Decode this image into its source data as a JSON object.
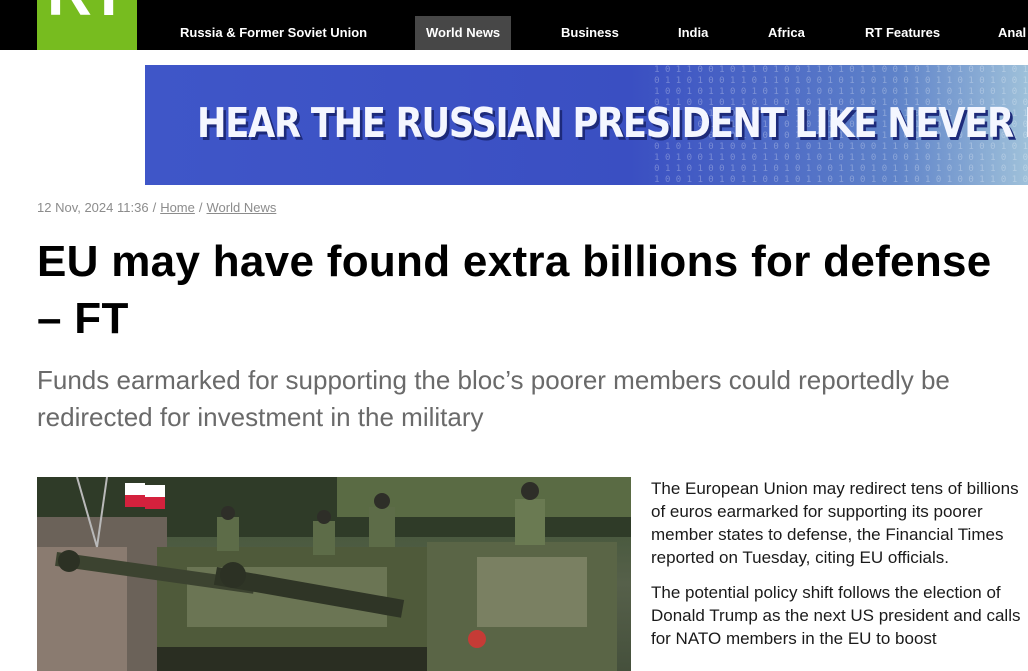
{
  "header": {
    "logo_text": "RT",
    "nav": [
      {
        "label": "Russia & Former Soviet Union"
      },
      {
        "label": "World News"
      },
      {
        "label": "Business"
      },
      {
        "label": "India"
      },
      {
        "label": "Africa"
      },
      {
        "label": "RT Features"
      },
      {
        "label": "Anal"
      }
    ],
    "active_index": 1
  },
  "banner": {
    "text": "HEAR THE RUSSIAN PRESIDENT LIKE NEVER BEFORE"
  },
  "breadcrumb": {
    "date": "12 Nov, 2024 11:36",
    "items": [
      "Home",
      "World News"
    ]
  },
  "article": {
    "title": "EU may have found extra billions for defense – FT",
    "summary": "Funds earmarked for supporting the bloc’s poorer members could reportedly be redirected for investment in the military",
    "paragraphs": [
      "The European Union may redirect tens of billions of euros earmarked for supporting its poorer member states to defense, the Financial Times reported on Tuesday, citing EU officials.",
      "The potential policy shift follows the election of Donald Trump as the next US president and calls for NATO members in the EU to boost"
    ]
  },
  "colors": {
    "brand_green": "#77bc1f",
    "nav_bg": "#000000",
    "nav_active_bg": "#474747",
    "banner_blue": "#3a4fc2"
  }
}
